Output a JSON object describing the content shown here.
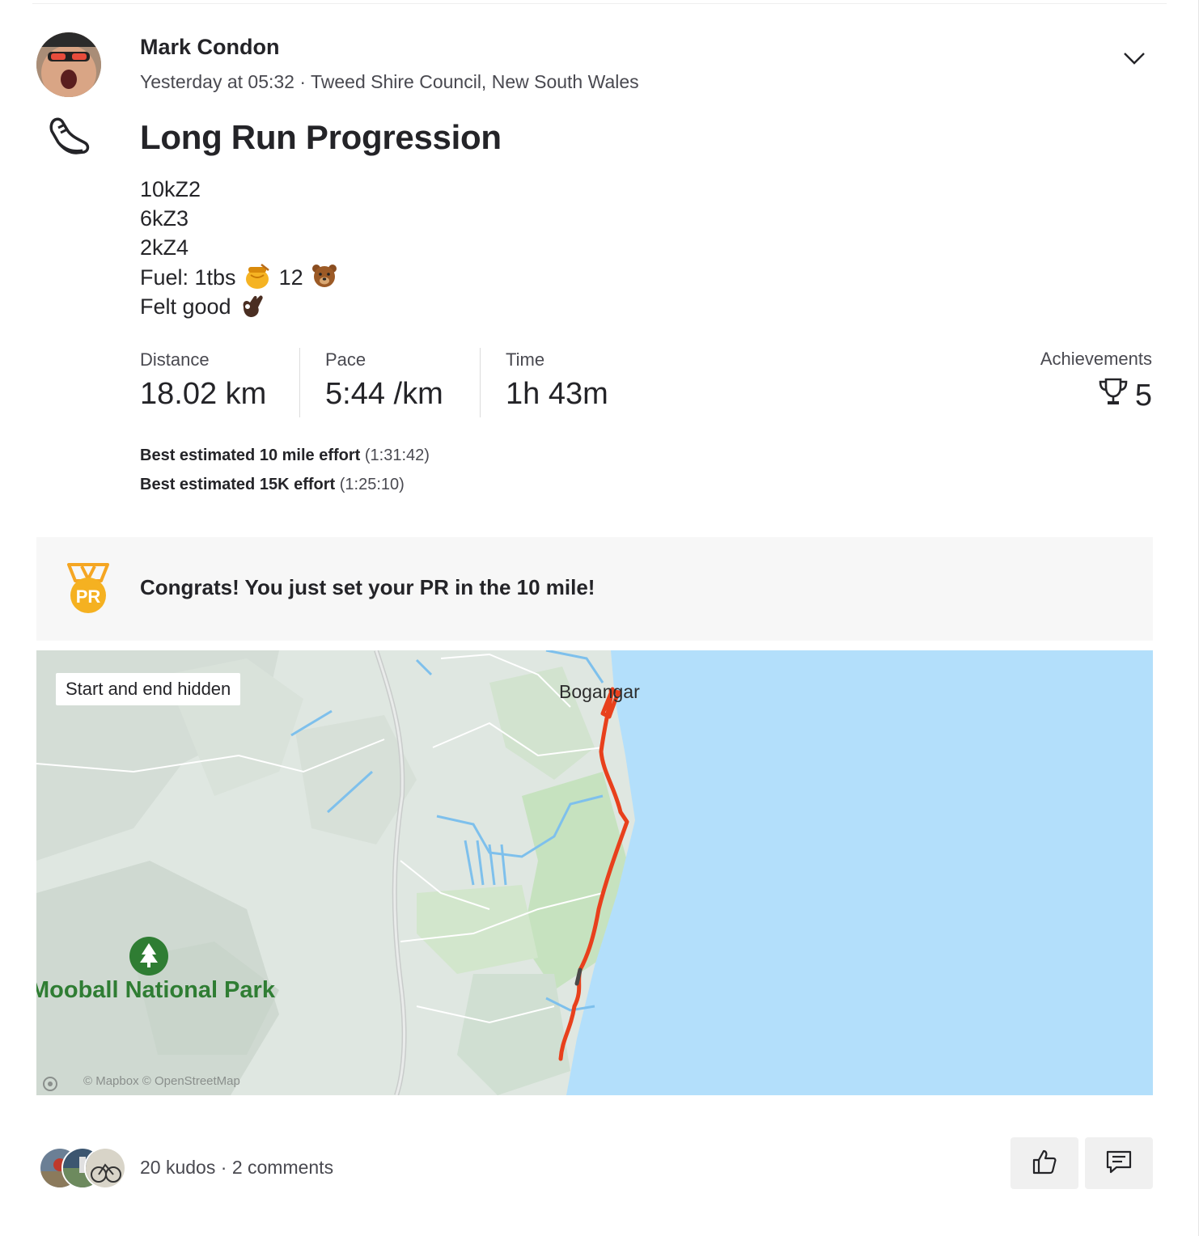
{
  "activity": {
    "athlete_name": "Mark Condon",
    "meta": "Yesterday at 05:32 · Tweed Shire Council, New South Wales",
    "title": "Long Run Progression",
    "description": {
      "line1": "10kZ2",
      "line2": "6kZ3",
      "line3": "2kZ4",
      "line4_before": "Fuel: 1tbs",
      "line4_mid": "12",
      "line5": "Felt good"
    },
    "stats": {
      "distance_label": "Distance",
      "distance_value": "18.02 km",
      "pace_label": "Pace",
      "pace_value": "5:44 /km",
      "time_label": "Time",
      "time_value": "1h 43m",
      "achievements_label": "Achievements",
      "achievements_value": "5"
    },
    "best_efforts": [
      {
        "label": "Best estimated 10 mile effort",
        "time": "(1:31:42)"
      },
      {
        "label": "Best estimated 15K effort",
        "time": "(1:25:10)"
      }
    ]
  },
  "pr_banner": {
    "text": "Congrats! You just set your PR in the 10 mile!",
    "badge": "PR"
  },
  "map": {
    "badge": "Start and end hidden",
    "town": "Bogangar",
    "park": "Mooball National Park",
    "attribution": "© Mapbox © OpenStreetMap",
    "colors": {
      "sea": "#b3dffb",
      "route": "#e8401c",
      "land": "#dfe7e1",
      "park": "#cfe4c9"
    }
  },
  "social": {
    "kudos": "20 kudos",
    "separator": "·",
    "comments": "2 comments"
  },
  "icons": {
    "menu": "chevron-down-icon",
    "sport": "running-shoe-icon",
    "achievements": "trophy-icon",
    "kudo_button": "thumbs-up-icon",
    "comment_button": "comment-icon"
  }
}
